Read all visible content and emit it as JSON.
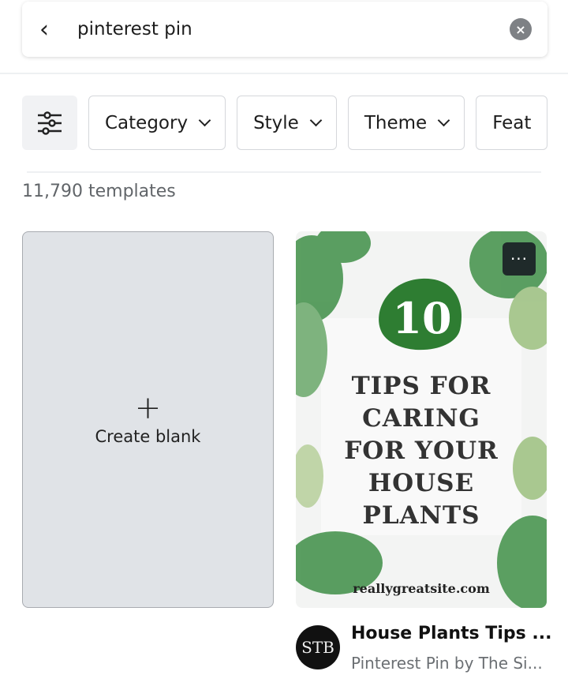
{
  "search": {
    "query": "pinterest pin",
    "back_icon": "chevron-left-icon",
    "clear_icon": "close-circle-icon"
  },
  "filters": {
    "icon": "sliders-icon",
    "chips": [
      {
        "label": "Category"
      },
      {
        "label": "Style"
      },
      {
        "label": "Theme"
      },
      {
        "label": "Feat"
      }
    ]
  },
  "results": {
    "count_text": "11,790 templates"
  },
  "create_blank": {
    "icon": "plus-icon",
    "label": "Create blank"
  },
  "template": {
    "number": "10",
    "lines": [
      "TIPS FOR",
      "CARING",
      "FOR YOUR",
      "HOUSE",
      "PLANTS"
    ],
    "site": "reallygreatsite.com",
    "more_label": "···",
    "title": "House Plants Tips ...",
    "subtitle": "Pinterest Pin by The Si...",
    "avatar_monogram": "STB"
  },
  "colors": {
    "accent_green": "#2e7d32",
    "chip_border": "#d5d7db",
    "blank_bg": "#e0e3e7"
  }
}
